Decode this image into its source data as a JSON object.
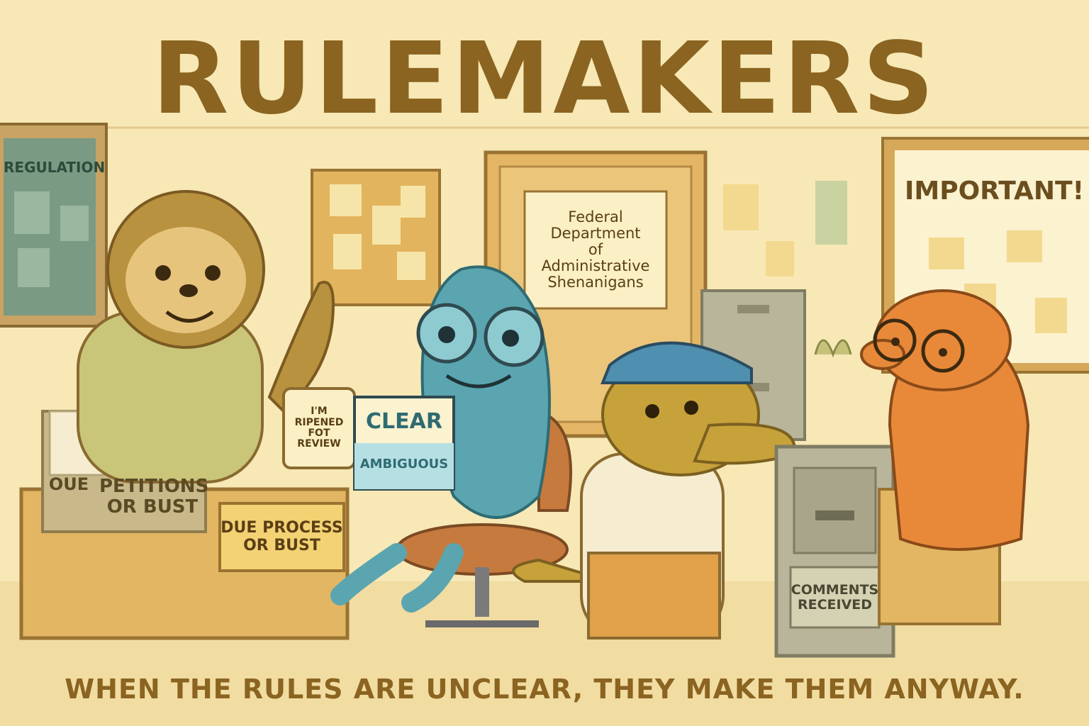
{
  "title": "RULEMAKERS",
  "tagline": "WHEN THE RULES ARE UNCLEAR, THEY MAKE THEM ANYWAY.",
  "left_board_label": "REGULATION",
  "door_sign": "Federal\nDepartment\nof\nAdministrative\nShenanigans",
  "right_board_label": "IMPORTANT!",
  "mug_text": "I'M\nRIPENED\nFOT\nREVIEW",
  "clear_sign_top": "CLEAR",
  "clear_sign_bottom": "AMBIGUOUS",
  "tray_left_label": "OUE",
  "tray_right_label": "PETITIONS\nOR BUST",
  "desk_sign": "DUE PROCESS\nOR BUST",
  "cabinet_label": "COMMENTS\nRECEIVED",
  "colors": {
    "background": "#f8ebbd",
    "title": "#8a6420",
    "chameleon": "#5aa5b0",
    "alligator": "#c7a23a",
    "mole": "#e8893a",
    "sloth": "#b9923f"
  }
}
